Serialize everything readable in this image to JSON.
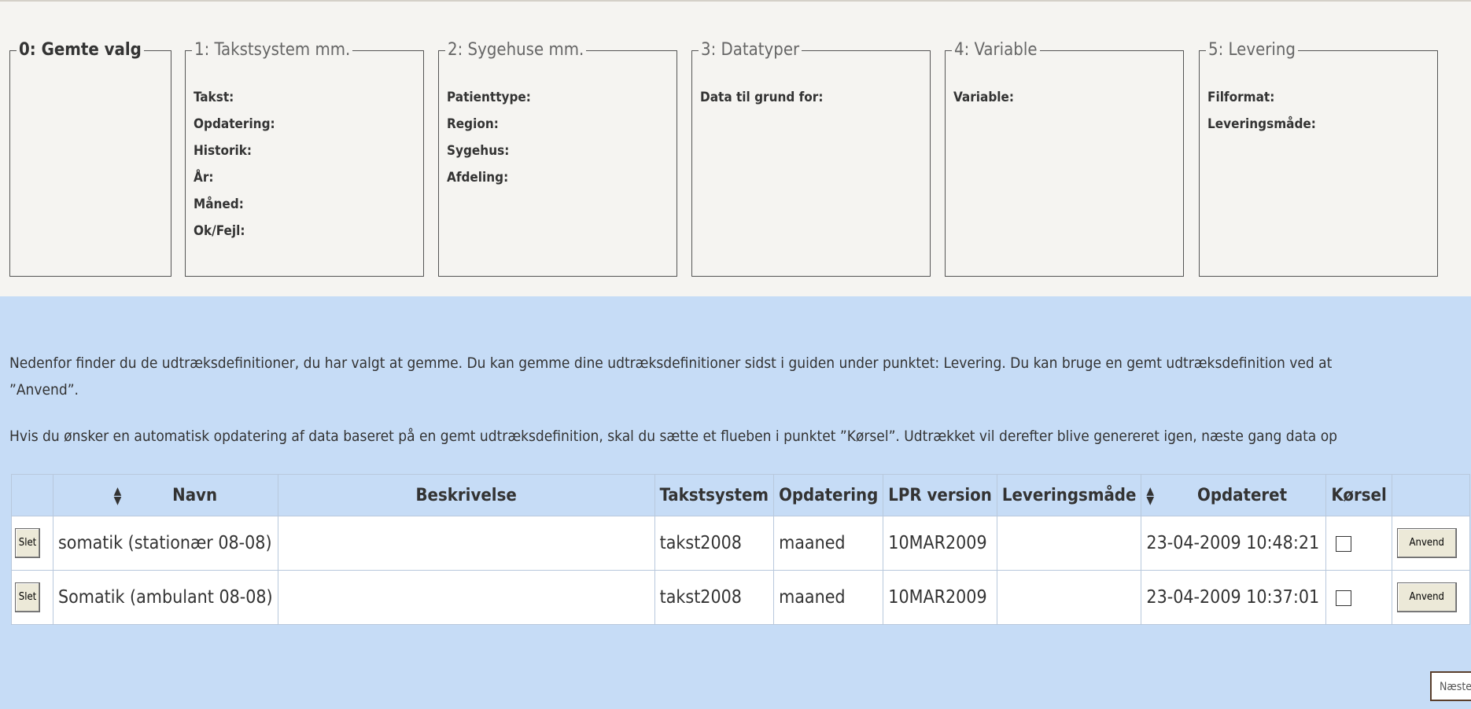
{
  "steps": [
    {
      "legend": "0: Gemte valg",
      "fields": []
    },
    {
      "legend": "1: Takstsystem mm.",
      "fields": [
        "Takst:",
        "Opdatering:",
        "Historik:",
        "År:",
        "Måned:",
        "Ok/Fejl:"
      ]
    },
    {
      "legend": "2: Sygehuse mm.",
      "fields": [
        "Patienttype:",
        "Region:",
        "Sygehus:",
        "Afdeling:"
      ]
    },
    {
      "legend": "3: Datatyper",
      "fields": [
        "Data til grund for:"
      ]
    },
    {
      "legend": "4: Variable",
      "fields": [
        "Variable:"
      ]
    },
    {
      "legend": "5: Levering",
      "fields": [
        "Filformat:",
        "Leveringsmåde:"
      ]
    }
  ],
  "info": {
    "line1": "Nedenfor finder du de udtræksdefinitioner, du har valgt at gemme. Du kan gemme dine udtræksdefinitioner sidst i guiden under punktet: Levering. Du kan bruge en gemt udtræksdefinition ved at",
    "line2": "”Anvend”.",
    "line3": "Hvis du ønsker en automatisk opdatering af data baseret på en gemt udtræksdefinition, skal du sætte et flueben i punktet ”Kørsel”. Udtrækket vil derefter blive genereret igen, næste gang data op"
  },
  "table": {
    "headers": {
      "navn": "Navn",
      "beskrivelse": "Beskrivelse",
      "takstsystem": "Takstsystem",
      "opdatering": "Opdatering",
      "lpr_version": "LPR version",
      "leveringsmaade": "Leveringsmåde",
      "opdateret": "Opdateret",
      "korsel": "Kørsel"
    },
    "rows": [
      {
        "slet": "Slet",
        "navn": "somatik (stationær 08-08)",
        "beskrivelse": "",
        "takstsystem": "takst2008",
        "opdatering": "maaned",
        "lpr_version": "10MAR2009",
        "leveringsmaade": "",
        "opdateret": "23-04-2009 10:48:21",
        "korsel": false,
        "anvend": "Anvend"
      },
      {
        "slet": "Slet",
        "navn": "Somatik (ambulant 08-08)",
        "beskrivelse": "",
        "takstsystem": "takst2008",
        "opdatering": "maaned",
        "lpr_version": "10MAR2009",
        "leveringsmaade": "",
        "opdateret": "23-04-2009 10:37:01",
        "korsel": false,
        "anvend": "Anvend"
      }
    ]
  },
  "next_button": "Næste",
  "icons": {
    "sort": "sort-updown-icon"
  }
}
